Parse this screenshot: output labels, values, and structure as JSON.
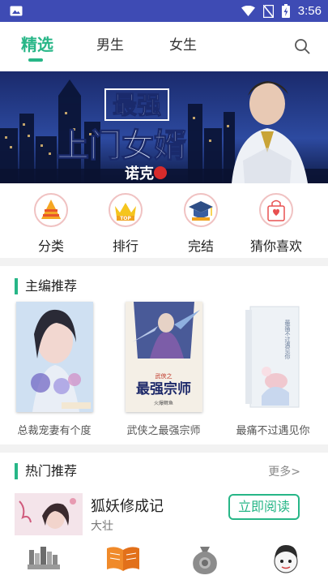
{
  "status_bar": {
    "time": "3:56"
  },
  "tabs": [
    {
      "label": "精选",
      "active": true
    },
    {
      "label": "男生",
      "active": false
    },
    {
      "label": "女生",
      "active": false
    }
  ],
  "banner": {
    "headline_1": "最强",
    "headline_2": "上门女婿",
    "author": "诺克"
  },
  "categories": [
    {
      "label": "分类",
      "icon": "pyramid-icon"
    },
    {
      "label": "排行",
      "icon": "crown-top-icon"
    },
    {
      "label": "完结",
      "icon": "graduation-cap-icon"
    },
    {
      "label": "猜你喜欢",
      "icon": "bag-icon"
    }
  ],
  "editor_picks": {
    "title": "主编推荐",
    "books": [
      {
        "title": "总裁宠妻有个度"
      },
      {
        "title": "武侠之最强宗师",
        "cover_text": "最强宗师",
        "cover_subtitle": "武侠之",
        "cover_author": "火爆鳏鱼"
      },
      {
        "title": "最痛不过遇见你",
        "cover_text": "最痛不过遇见你"
      }
    ]
  },
  "hot": {
    "title": "热门推荐",
    "more": "更多>",
    "item": {
      "title": "狐妖修成记",
      "author": "大壮",
      "button": "立即阅读"
    }
  },
  "colors": {
    "accent": "#27b687",
    "status_bar": "#3e4bb4"
  }
}
